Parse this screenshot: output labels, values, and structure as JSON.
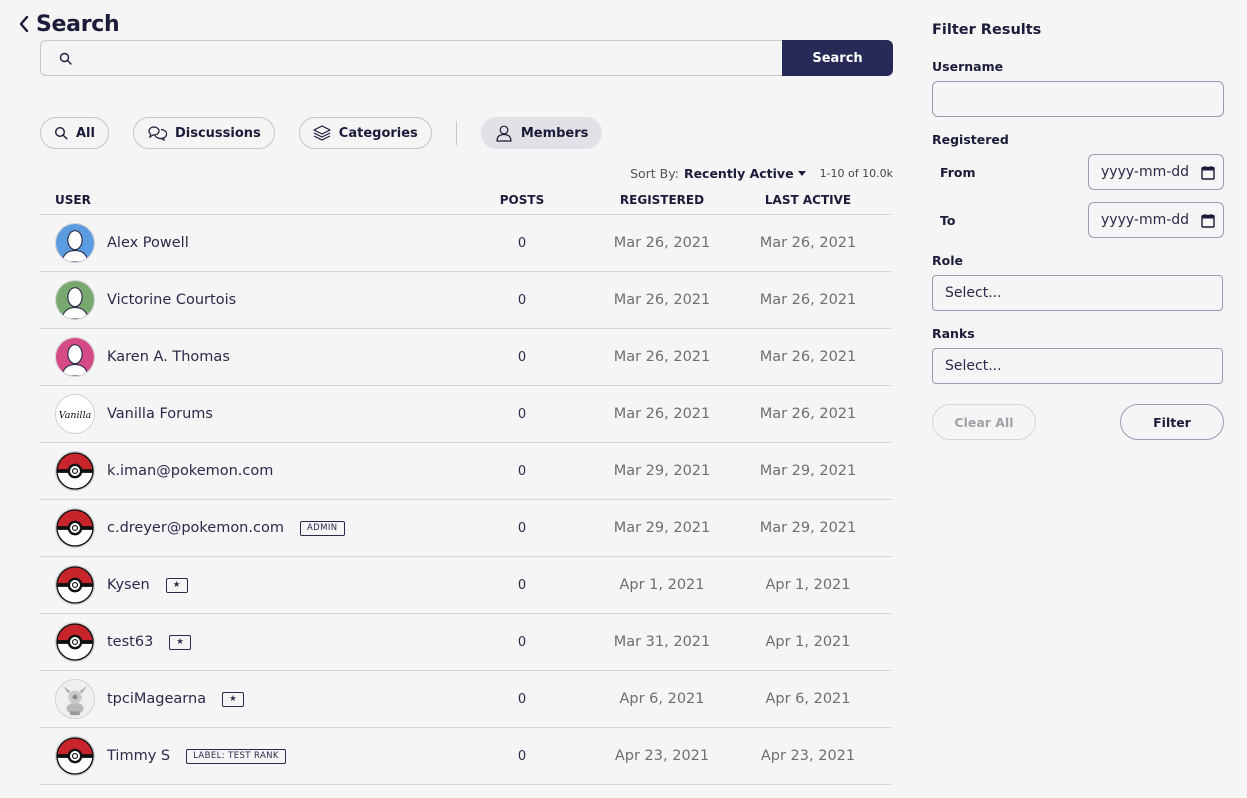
{
  "header": {
    "title": "Search",
    "back_icon": "chevron-left-icon"
  },
  "search": {
    "value": "",
    "placeholder": "",
    "button_label": "Search"
  },
  "tabs": [
    {
      "label": "All",
      "icon": "search-icon",
      "active": false
    },
    {
      "label": "Discussions",
      "icon": "discussions-icon",
      "active": false
    },
    {
      "label": "Categories",
      "icon": "layers-icon",
      "active": false
    },
    {
      "label": "Members",
      "icon": "user-icon",
      "active": true
    }
  ],
  "sort": {
    "label": "Sort By:",
    "value": "Recently Active",
    "pager": "1-10 of 10.0k"
  },
  "table": {
    "headers": {
      "user": "USER",
      "posts": "POSTS",
      "registered": "REGISTERED",
      "last_active": "LAST ACTIVE"
    },
    "rows": [
      {
        "name": "Alex Powell",
        "badge": "",
        "posts": "0",
        "registered": "Mar 26, 2021",
        "last_active": "Mar 26, 2021",
        "avatar": "default-blue"
      },
      {
        "name": "Victorine Courtois",
        "badge": "",
        "posts": "0",
        "registered": "Mar 26, 2021",
        "last_active": "Mar 26, 2021",
        "avatar": "default-green"
      },
      {
        "name": "Karen A. Thomas",
        "badge": "",
        "posts": "0",
        "registered": "Mar 26, 2021",
        "last_active": "Mar 26, 2021",
        "avatar": "default-pink"
      },
      {
        "name": "Vanilla Forums",
        "badge": "",
        "posts": "0",
        "registered": "Mar 26, 2021",
        "last_active": "Mar 26, 2021",
        "avatar": "vanilla-logo",
        "avatar_text": "Vanilla"
      },
      {
        "name": "k.iman@pokemon.com",
        "badge": "",
        "posts": "0",
        "registered": "Mar 29, 2021",
        "last_active": "Mar 29, 2021",
        "avatar": "pokeball"
      },
      {
        "name": "c.dreyer@pokemon.com",
        "badge": "ADMIN",
        "posts": "0",
        "registered": "Mar 29, 2021",
        "last_active": "Mar 29, 2021",
        "avatar": "pokeball"
      },
      {
        "name": "Kysen",
        "badge": "★",
        "posts": "0",
        "registered": "Apr 1, 2021",
        "last_active": "Apr 1, 2021",
        "avatar": "pokeball"
      },
      {
        "name": "test63",
        "badge": "★",
        "posts": "0",
        "registered": "Mar 31, 2021",
        "last_active": "Apr 1, 2021",
        "avatar": "pokeball"
      },
      {
        "name": "tpciMagearna",
        "badge": "★",
        "posts": "0",
        "registered": "Apr 6, 2021",
        "last_active": "Apr 6, 2021",
        "avatar": "magearna"
      },
      {
        "name": "Timmy S",
        "badge": "LABEL: TEST RANK",
        "posts": "0",
        "registered": "Apr 23, 2021",
        "last_active": "Apr 23, 2021",
        "avatar": "pokeball"
      }
    ]
  },
  "filter": {
    "title": "Filter Results",
    "username_label": "Username",
    "username_value": "",
    "registered_label": "Registered",
    "from_label": "From",
    "to_label": "To",
    "date_placeholder": "yyyy-mm-dd",
    "role_label": "Role",
    "role_value": "Select...",
    "ranks_label": "Ranks",
    "ranks_value": "Select...",
    "clear_label": "Clear All",
    "filter_label": "Filter"
  },
  "colors": {
    "primary": "#262a57",
    "background": "#f5f5f5",
    "border": "#d6d6dc",
    "muted_text": "#6e6e6e"
  }
}
